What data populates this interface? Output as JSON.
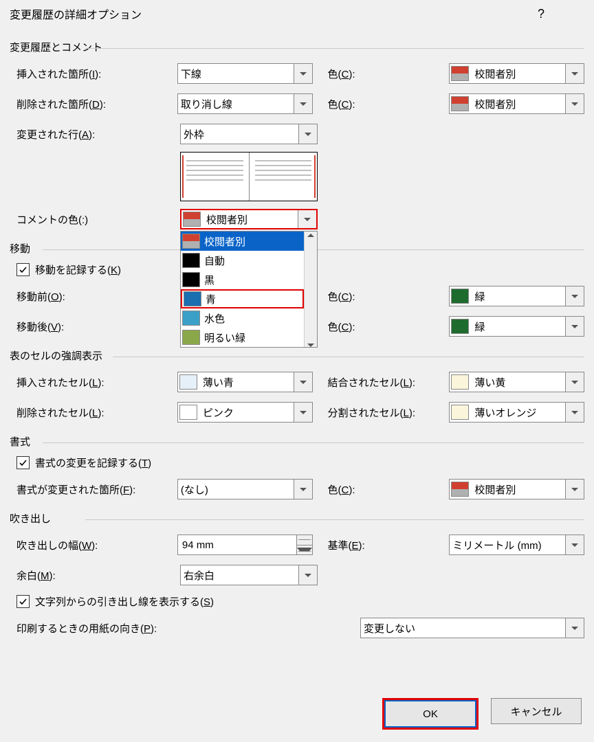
{
  "title": "変更履歴の詳細オプション",
  "sections": {
    "s1": "変更履歴とコメント",
    "s2": "移動",
    "s3": "表のセルの強調表示",
    "s4": "書式",
    "s5": "吹き出し"
  },
  "labels": {
    "insertions_pre": "挿入された箇所(",
    "insertions_u": "I",
    "insertions_post": "):",
    "deletions_pre": "削除された箇所(",
    "deletions_u": "D",
    "deletions_post": "):",
    "changed_pre": "変更された行(",
    "changed_u": "A",
    "changed_post": "):",
    "comment_color": "コメントの色(:)",
    "color_pre": "色(",
    "color_u": "C",
    "color_post": "):",
    "track_moves_pre": "移動を記録する(",
    "track_moves_u": "K",
    "track_moves_post": ")",
    "moved_from_pre": "移動前(",
    "moved_from_u": "O",
    "moved_from_post": "):",
    "moved_to_pre": "移動後(",
    "moved_to_u": "V",
    "moved_to_post": "):",
    "ins_cells_pre": "挿入されたセル(",
    "ins_cells_u": "L",
    "ins_cells_post": "):",
    "del_cells_pre": "削除されたセル(",
    "del_cells_u": "L",
    "del_cells_post": "):",
    "merged_pre": "結合されたセル(",
    "merged_u": "L",
    "merged_post": "):",
    "split_pre": "分割されたセル(",
    "split_u": "L",
    "split_post": "):",
    "track_fmt_pre": "書式の変更を記録する(",
    "track_fmt_u": "T",
    "track_fmt_post": ")",
    "fmt_changed_pre": "書式が変更された箇所(",
    "fmt_changed_u": "F",
    "fmt_changed_post": "):",
    "balloon_w_pre": "吹き出しの幅(",
    "balloon_w_u": "W",
    "balloon_w_post": "):",
    "measure_pre": "基準(",
    "measure_u": "E",
    "measure_post": "):",
    "margin_pre": "余白(",
    "margin_u": "M",
    "margin_post": "):",
    "show_lines_pre": "文字列からの引き出し線を表示する(",
    "show_lines_u": "S",
    "show_lines_post": ")",
    "print_orient_pre": "印刷するときの用紙の向き(",
    "print_orient_u": "P",
    "print_orient_post": "):"
  },
  "values": {
    "insertions": "下線",
    "deletions": "取り消し線",
    "changed_lines": "外枠",
    "comment_color": "校閲者別",
    "ins_color": "校閲者別",
    "del_color": "校閲者別",
    "moved_from_color": "緑",
    "moved_to_color": "緑",
    "ins_cells": "薄い青",
    "del_cells": "ピンク",
    "merged": "薄い黄",
    "split": "薄いオレンジ",
    "formatting": "(なし)",
    "fmt_color": "校閲者別",
    "balloon_width": "94 mm",
    "measure": "ミリメートル (mm)",
    "margin": "右余白",
    "print_orient": "変更しない"
  },
  "dropdown_items": [
    "校閲者別",
    "自動",
    "黒",
    "青",
    "水色",
    "明るい緑"
  ],
  "buttons": {
    "ok": "OK",
    "cancel": "キャンセル"
  }
}
